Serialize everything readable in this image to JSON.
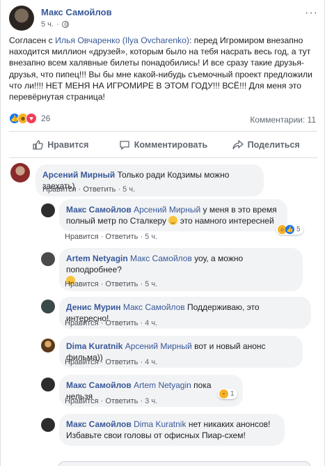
{
  "post": {
    "author": "Макс Самойлов",
    "time": "5 ч.",
    "more_glyph": "···",
    "text_before_link": "Согласен с ",
    "link_text": "Илья Овчаренко (Ilya Ovcharenko)",
    "text_after_link": ": перед Игромиром внезапно находится миллион «друзей», которым было на тебя насрать весь год, а тут внезапно всем халявные билеты понадобились! И все сразу такие друзья-друзья, что пипец!!! Вы бы мне какой-нибудь съемочный проект предложили что ли!!!! НЕТ МЕНЯ НА ИГРОМИРЕ В ЭТОМ ГОДУ!!! ВСЁ!!! Для меня это перевёрнутая страница!",
    "reactions_count": "26",
    "comments_count": "Комментарии: 11"
  },
  "actions": {
    "like": "Нравится",
    "comment": "Комментировать",
    "share": "Поделиться"
  },
  "comment_labels": {
    "like": "Нравится",
    "reply": "Ответить",
    "sep": "·"
  },
  "comments": [
    {
      "author": "Арсений Мирный",
      "mention": "",
      "text": "Только ради Кодзимы можно заехать)",
      "time": "5 ч."
    },
    {
      "author": "Макс Самойлов",
      "mention": "Арсений Мирный",
      "text": "у меня в это время полный метр по Сталкеру",
      "text2": "это намного интересней",
      "time": "5 ч.",
      "react_count": "5"
    },
    {
      "author": "Artem Netyagin",
      "mention": "Макс Самойлов",
      "text": "уоу, а можно поподробнее?",
      "time": "5 ч."
    },
    {
      "author": "Денис Мурин",
      "mention": "Макс Самойлов",
      "text": "Поддерживаю, это интересно!",
      "time": "4 ч."
    },
    {
      "author": "Dima Kuratnik",
      "mention": "Арсений Мирный",
      "text": "вот и новый анонс фильма))",
      "time": "4 ч."
    },
    {
      "author": "Макс Самойлов",
      "mention": "Artem Netyagin",
      "text": "пока нельзя",
      "time": "3 ч.",
      "react_count": "1"
    },
    {
      "author": "Макс Самойлов",
      "mention": "Dima Kuratnik",
      "text": "нет никаких анонсов! Избавьте свои головы от офисных Пиар-схем!",
      "time": "3 ч."
    }
  ]
}
